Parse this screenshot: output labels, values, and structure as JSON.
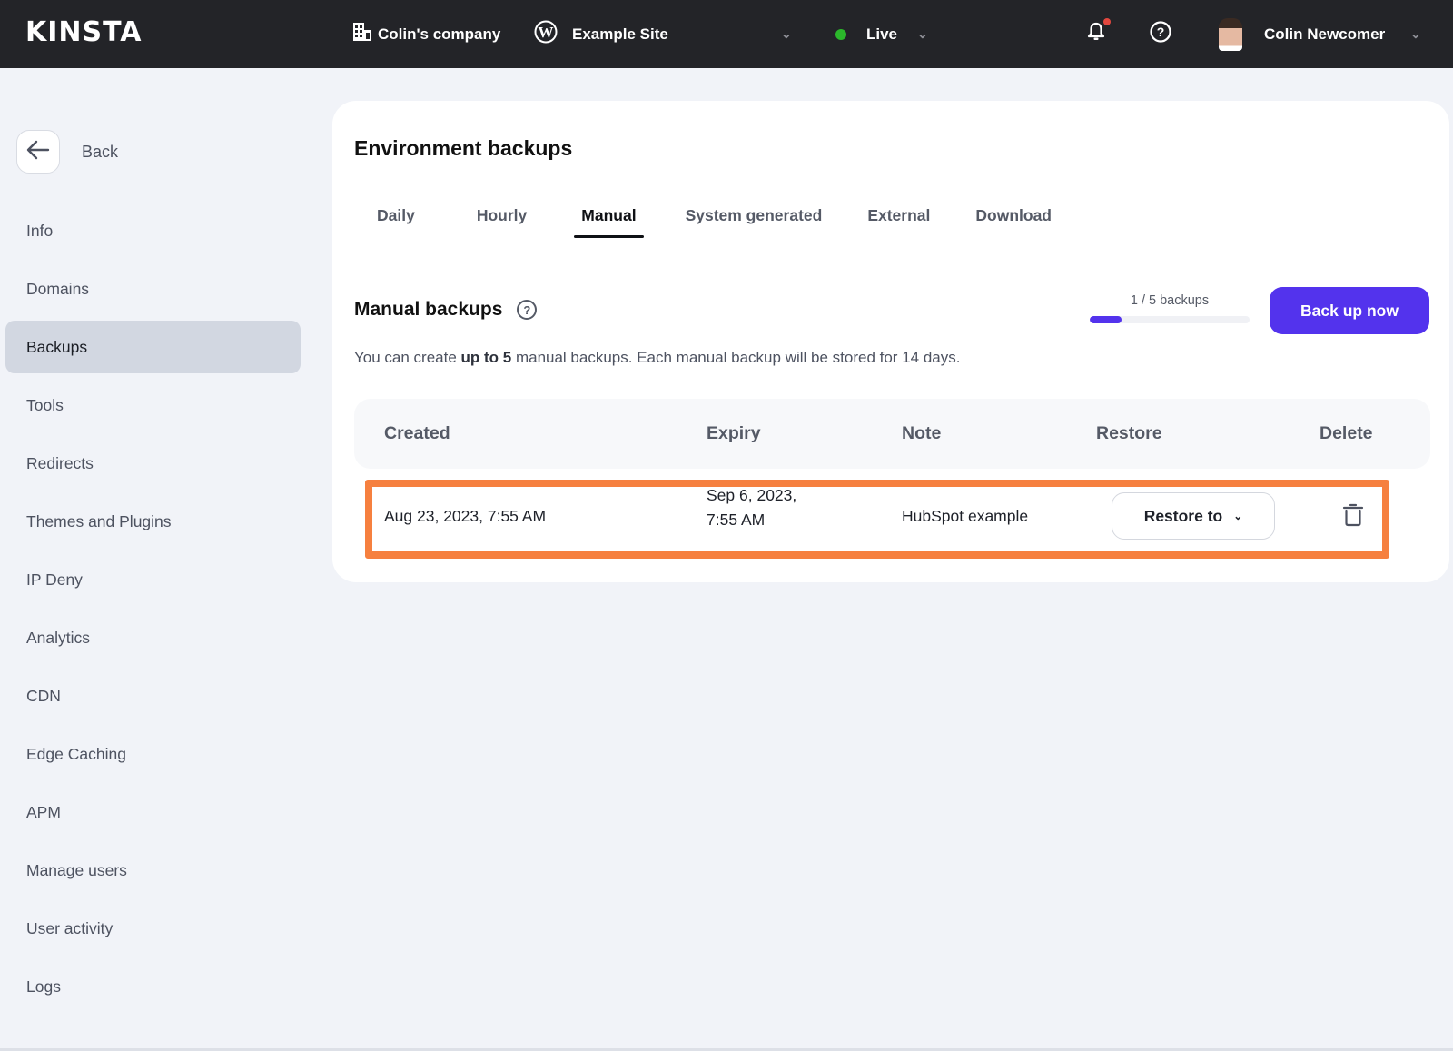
{
  "topbar": {
    "logo": "KINSTA",
    "company": "Colin's company",
    "site": "Example Site",
    "environment": "Live",
    "environment_status_color": "#2bb72b",
    "user_name": "Colin Newcomer",
    "icons": {
      "company": "building-icon",
      "site": "wordpress-icon",
      "notifications": "bell-icon",
      "help": "question-circle-icon"
    }
  },
  "sidebar": {
    "back_label": "Back",
    "items": [
      {
        "label": "Info"
      },
      {
        "label": "Domains"
      },
      {
        "label": "Backups",
        "active": true
      },
      {
        "label": "Tools"
      },
      {
        "label": "Redirects"
      },
      {
        "label": "Themes and Plugins"
      },
      {
        "label": "IP Deny"
      },
      {
        "label": "Analytics"
      },
      {
        "label": "CDN"
      },
      {
        "label": "Edge Caching"
      },
      {
        "label": "APM"
      },
      {
        "label": "Manage users"
      },
      {
        "label": "User activity"
      },
      {
        "label": "Logs"
      }
    ]
  },
  "main": {
    "title": "Environment backups",
    "tabs": [
      {
        "label": "Daily"
      },
      {
        "label": "Hourly"
      },
      {
        "label": "Manual",
        "active": true
      },
      {
        "label": "System generated"
      },
      {
        "label": "External"
      },
      {
        "label": "Download"
      }
    ],
    "section_title": "Manual backups",
    "description": {
      "before": "You can create ",
      "bold": "up to 5",
      "after": " manual backups. Each manual backup will be stored for 14 days."
    },
    "quota": {
      "label": "1 / 5 backups",
      "used": 1,
      "max": 5,
      "fraction": 0.2
    },
    "backup_now_label": "Back up now",
    "accent_color": "#5333ed",
    "highlight_color": "#f6803f",
    "table": {
      "columns": [
        "Created",
        "Expiry",
        "Note",
        "Restore",
        "Delete"
      ],
      "rows": [
        {
          "created": "Aug 23, 2023, 7:55 AM",
          "expiry_line1": "Sep 6, 2023,",
          "expiry_line2": "7:55 AM",
          "note": "HubSpot example",
          "restore_label": "Restore to"
        }
      ]
    }
  }
}
